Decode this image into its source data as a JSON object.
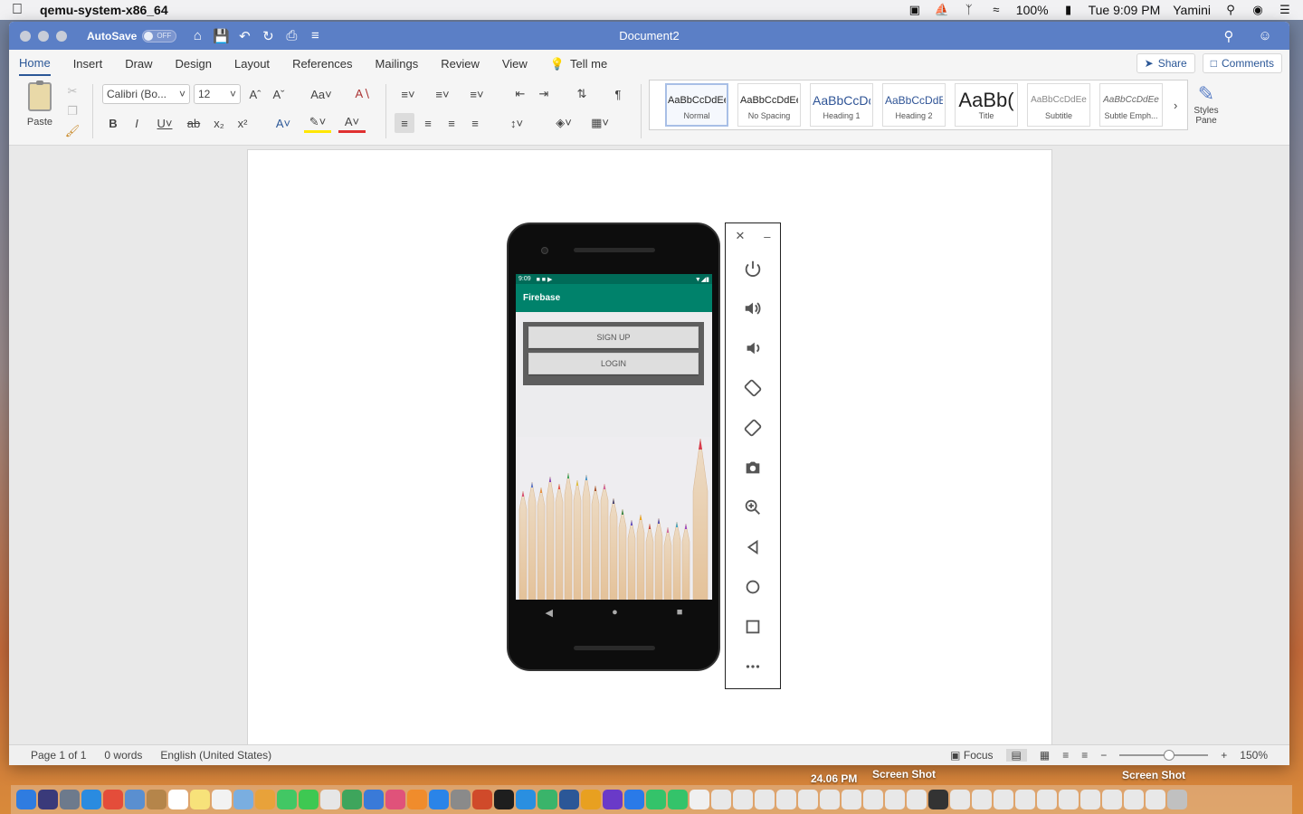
{
  "menubar": {
    "app_name": "qemu-system-x86_64",
    "battery": "100%",
    "clock": "Tue 9:09 PM",
    "user": "Yamini"
  },
  "window": {
    "autosave_label": "AutoSave",
    "autosave_state": "OFF",
    "document_title": "Document2"
  },
  "tabs": {
    "items": [
      "Home",
      "Insert",
      "Draw",
      "Design",
      "Layout",
      "References",
      "Mailings",
      "Review",
      "View"
    ],
    "tell_me": "Tell me",
    "share": "Share",
    "comments": "Comments"
  },
  "ribbon": {
    "paste_label": "Paste",
    "font_name": "Calibri (Bo...",
    "font_size": "12",
    "case_label": "Aa",
    "styles": [
      {
        "preview": "AaBbCcDdEe",
        "name": "Normal"
      },
      {
        "preview": "AaBbCcDdEe",
        "name": "No Spacing"
      },
      {
        "preview": "AaBbCcDc",
        "name": "Heading 1"
      },
      {
        "preview": "AaBbCcDdEe",
        "name": "Heading 2"
      },
      {
        "preview": "AaBb(",
        "name": "Title"
      },
      {
        "preview": "AaBbCcDdEe",
        "name": "Subtitle"
      },
      {
        "preview": "AaBbCcDdEe",
        "name": "Subtle Emph..."
      }
    ],
    "styles_pane_label": "Styles Pane"
  },
  "emulator": {
    "status_time": "9:09",
    "app_title": "Firebase",
    "signup_label": "SIGN UP",
    "login_label": "LOGIN",
    "panel_buttons": [
      "power-icon",
      "volume-up-icon",
      "volume-down-icon",
      "rotate-left-icon",
      "rotate-right-icon",
      "camera-icon",
      "zoom-icon",
      "back-icon",
      "home-icon",
      "overview-icon",
      "more-icon"
    ]
  },
  "statusbar": {
    "page": "Page 1 of 1",
    "words": "0 words",
    "language": "English (United States)",
    "focus": "Focus",
    "zoom": "150%"
  },
  "dock_labels": {
    "label1": "Screen Shot",
    "label2": "Screen Shot",
    "label3": "24.06 PM"
  },
  "colors": {
    "titlebar": "#5b7fc6",
    "android_appbar": "#00826b",
    "accent": "#2b5797"
  }
}
